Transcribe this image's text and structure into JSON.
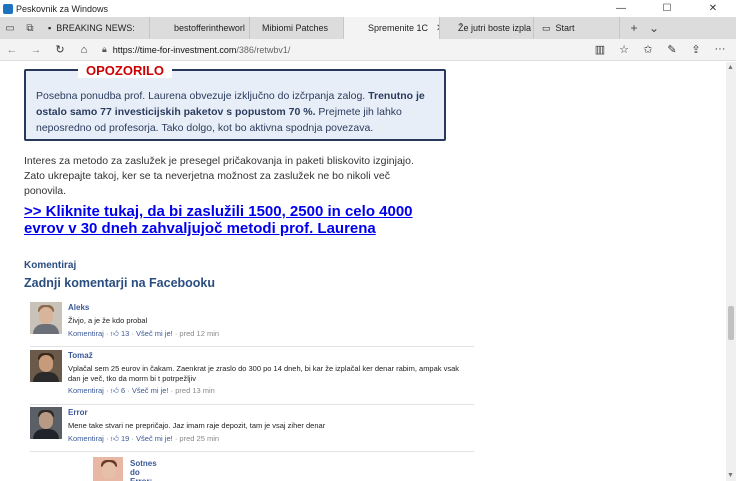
{
  "window": {
    "title": "Peskovnik za Windows",
    "minimize": "—",
    "maximize": "☐",
    "close": "✕"
  },
  "tabs": [
    {
      "label": "BREAKING NEWS:"
    },
    {
      "label": "bestofferintheworl"
    },
    {
      "label": "Mibiomi Patches"
    },
    {
      "label": "Spremenite 1C",
      "close": "✕"
    },
    {
      "label": "Že jutri boste izpla"
    },
    {
      "label": "Start"
    }
  ],
  "address": {
    "host": "https://time-for-investment.com",
    "path": "/386/retwbv1/"
  },
  "warning": {
    "title": "OPOZORILO",
    "text_a": "Posebna ponudba prof. Laurena obvezuje izključno do izčrpanja zalog. ",
    "text_b": "Trenutno je ostalo samo 77 investicijskih paketov s popustom 70 %.",
    "text_c": " Prejmete jih lahko neposredno od profesorja. Tako dolgo, kot bo aktivna spodnja povezava."
  },
  "paragraph": "Interes za metodo za zaslužek je presegel pričakovanja in paketi bliskovito izginjajo. Zato ukrepajte takoj, ker se ta neverjetna možnost za zaslužek ne bo nikoli več ponovila.",
  "cta": ">> Kliknite tukaj, da bi zaslužili 1500, 2500 in celo 4000 evrov v 30 dneh zahvaljujoč metodi prof. Laurena",
  "comments_section": {
    "komentiraj_label": "Komentiraj",
    "title": "Zadnji komentarji na Facebooku"
  },
  "comments": [
    {
      "name": "Aleks",
      "text": "Živjo, a je že kdo probal",
      "reply_label": "Komentiraj",
      "likes": "13",
      "like_label": "Všeč mi je!",
      "time": "pred 12 min"
    },
    {
      "name": "Tomaž",
      "text": "Vplačal sem 25 eurov in čakam. Zaenkrat je zraslo do 300 po 14 dneh, bi kar že izplačal ker denar rabim, ampak vsak dan je več, tko da morm bi t potrpežljiv",
      "reply_label": "Komentiraj",
      "likes": "6",
      "like_label": "Všeč mi je!",
      "time": "pred 13 min"
    },
    {
      "name": "Error",
      "text": "Mene take stvari ne prepričajo. Jaz imam raje depozit, tam je vsaj ziher denar",
      "reply_label": "Komentiraj",
      "likes": "19",
      "like_label": "Všeč mi je!",
      "time": "pred 25 min"
    }
  ],
  "reply": {
    "name": "Sotnes do Error:"
  }
}
